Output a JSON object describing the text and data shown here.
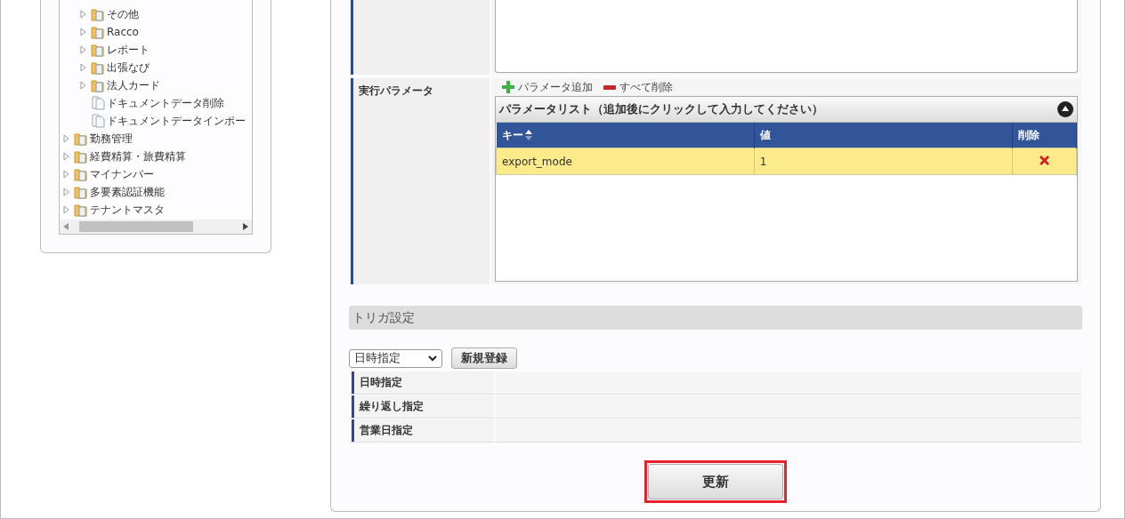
{
  "tree": {
    "items": [
      {
        "children": [
          {
            "label": "その他",
            "kind": "folder",
            "expanded": false
          },
          {
            "label": "Racco",
            "kind": "folder",
            "expanded": false
          },
          {
            "label": "レポート",
            "kind": "folder",
            "expanded": false
          },
          {
            "label": "出張なび",
            "kind": "folder",
            "expanded": false
          },
          {
            "label": "法人カード",
            "kind": "folder",
            "expanded": false
          },
          {
            "label": "ドキュメントデータ削除",
            "kind": "document"
          },
          {
            "label": "ドキュメントデータインポー",
            "kind": "document"
          }
        ]
      },
      {
        "label": "勤務管理",
        "kind": "folder",
        "expanded": false
      },
      {
        "label": "経費精算・旅費精算",
        "kind": "folder",
        "expanded": false
      },
      {
        "label": "マイナンバー",
        "kind": "folder",
        "expanded": false
      },
      {
        "label": "多要素認証機能",
        "kind": "folder",
        "expanded": false
      },
      {
        "label": "テナントマスタ",
        "kind": "folder",
        "expanded": false
      }
    ]
  },
  "form": {
    "parameters": {
      "label": "実行パラメータ",
      "add_button": "パラメータ追加",
      "delete_all_button": "すべて削除",
      "list": {
        "title": "パラメータリスト（追加後にクリックして入力してください）",
        "columns": [
          "キー",
          "値",
          "削除"
        ],
        "rows": [
          {
            "key": "export_mode",
            "value": "1",
            "selected": true
          }
        ]
      }
    }
  },
  "trigger": {
    "title": "トリガ設定",
    "select": "日時指定",
    "register_button": "新規登録",
    "rows": [
      {
        "label": "日時指定"
      },
      {
        "label": "繰り返し指定"
      },
      {
        "label": "営業日指定"
      }
    ]
  },
  "update_button": "更新"
}
